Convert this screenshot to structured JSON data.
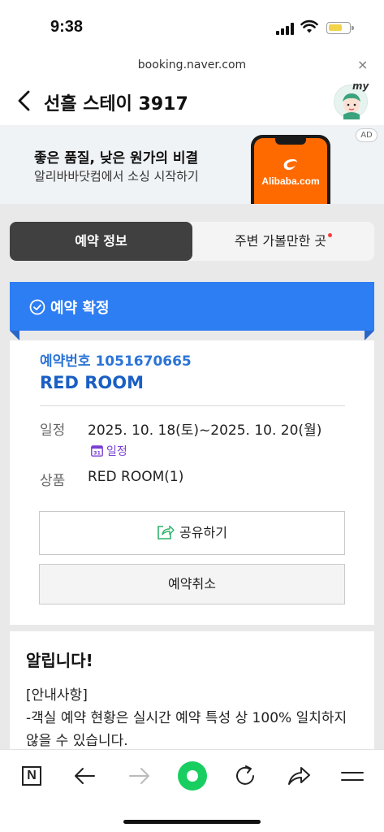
{
  "status_bar": {
    "time": "9:38"
  },
  "browser": {
    "url": "booking.naver.com",
    "close_label": "×"
  },
  "header": {
    "title": "선흘 스테이 3917",
    "avatar_badge": "my"
  },
  "ad": {
    "headline": "좋은 품질, 낮은 원가의 비결",
    "subtext": "알리바바닷컴에서 소싱 시작하기",
    "badge": "AD",
    "brand": "Alibaba.com",
    "brand_color": "#ff6a00"
  },
  "tabs": [
    {
      "label": "예약 정보",
      "active": true
    },
    {
      "label": "주변 가볼만한 곳",
      "active": false,
      "has_dot": true
    }
  ],
  "status_banner": {
    "label": "예약 확정",
    "color": "#2d7df3"
  },
  "reservation": {
    "number": "예약번호 1051670665",
    "room": "RED ROOM",
    "schedule_label": "일정",
    "schedule_value": "2025. 10. 18(토)~2025. 10. 20(월)",
    "calendar_link": "일정",
    "calendar_day": "31",
    "product_label": "상품",
    "product_value": "RED ROOM(1)",
    "share_button": "공유하기",
    "cancel_button": "예약취소"
  },
  "notice": {
    "title": "알립니다!",
    "lines": [
      "[안내사항]",
      "-객실 예약 현황은 실시간 예약 특성 상 100% 일치하지",
      "않을 수 있습니다."
    ]
  },
  "bottom_nav": {
    "items": [
      "naver-home-icon",
      "back-arrow-icon",
      "forward-arrow-icon",
      "green-dot-icon",
      "refresh-icon",
      "share-icon",
      "menu-icon"
    ],
    "naver_letter": "N"
  }
}
